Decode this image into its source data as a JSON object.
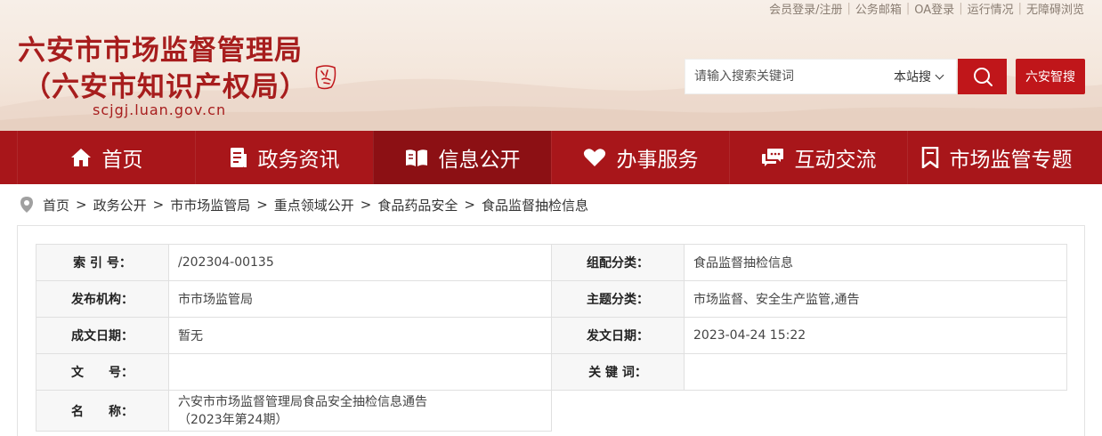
{
  "toplinks": [
    "会员登录/注册",
    "公务邮箱",
    "OA登录",
    "运行情况",
    "无障碍浏览"
  ],
  "logo": {
    "line1": "六安市市场监督管理局",
    "line2": "（六安市知识产权局）",
    "domain": "scjgj.luan.gov.cn"
  },
  "search": {
    "placeholder": "请输入搜索关键词",
    "scope": "本站搜",
    "smart_button": "六安智搜"
  },
  "nav": [
    {
      "label": "首页",
      "icon": "home-icon"
    },
    {
      "label": "政务资讯",
      "icon": "document-icon"
    },
    {
      "label": "信息公开",
      "icon": "open-book-icon",
      "active": true
    },
    {
      "label": "办事服务",
      "icon": "heart-icon"
    },
    {
      "label": "互动交流",
      "icon": "chat-icon"
    },
    {
      "label": "市场监管专题",
      "icon": "bookmark-icon"
    }
  ],
  "breadcrumb": [
    "首页",
    "政务公开",
    "市市场监管局",
    "重点领域公开",
    "食品药品安全",
    "食品监督抽检信息"
  ],
  "meta": {
    "index_label": "索 引 号：",
    "index_value": "/202304-00135",
    "category_label": "组配分类：",
    "category_value": "食品监督抽检信息",
    "publisher_label": "发布机构：",
    "publisher_value": "市市场监管局",
    "topic_label": "主题分类：",
    "topic_value": "市场监督、安全生产监管,通告",
    "created_label": "成文日期：",
    "created_value": "暂无",
    "published_label": "发文日期：",
    "published_value": "2023-04-24 15:22",
    "doc_no_label": "文　　号：",
    "doc_no_value": "",
    "keywords_label": "关 键 词：",
    "keywords_value": "",
    "name_label": "名　　称：",
    "name_value_line1": "六安市市场监督管理局食品安全抽检信息通告",
    "name_value_line2": "（2023年第24期）"
  },
  "colors": {
    "brand_red": "#a8161a",
    "nav_active": "#8c1014",
    "search_red": "#c0161a",
    "logo_red": "#a71d1d"
  }
}
